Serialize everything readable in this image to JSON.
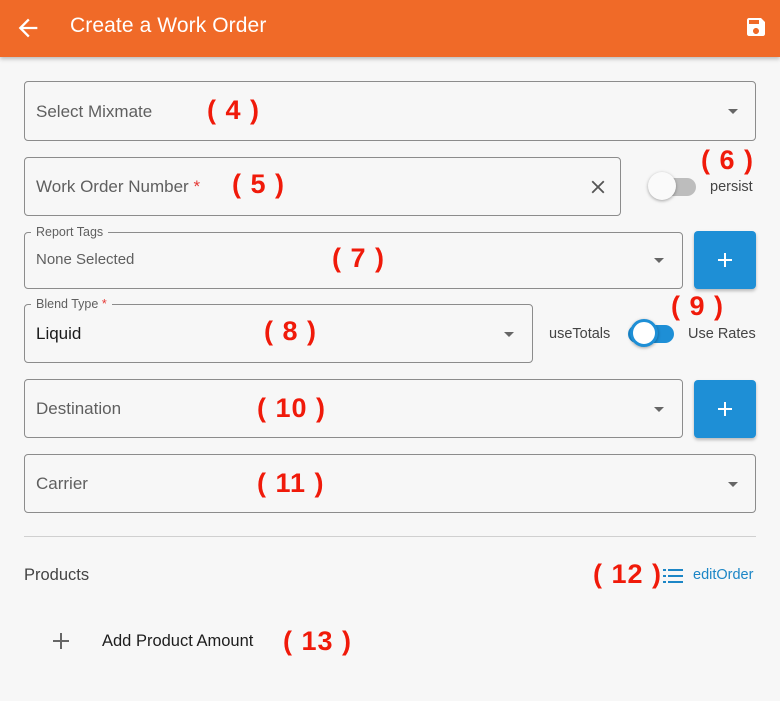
{
  "appbar": {
    "title": "Create a Work Order",
    "back_icon": "arrow-left-icon",
    "save_icon": "save-icon",
    "color": "#f06a28"
  },
  "form": {
    "mixmate": {
      "placeholder": "Select Mixmate"
    },
    "work_order": {
      "placeholder": "Work Order Number",
      "required_mark": "*",
      "clear_icon": "close-icon"
    },
    "persist": {
      "label": "persist",
      "on": false
    },
    "report_tags": {
      "legend": "Report Tags",
      "value": "None Selected"
    },
    "blend_type": {
      "legend": "Blend Type",
      "required_mark": "*",
      "value": "Liquid"
    },
    "use_totals": {
      "left_label": "useTotals",
      "right_label": "Use Rates",
      "on": true
    },
    "destination": {
      "placeholder": "Destination"
    },
    "carrier": {
      "placeholder": "Carrier"
    },
    "add_button_color": "#1e8fd6"
  },
  "products": {
    "heading": "Products",
    "edit_order_label": "editOrder",
    "add_product_label": "Add Product Amount"
  },
  "annotations": {
    "a4": "( 4 )",
    "a5": "( 5 )",
    "a6": "( 6 )",
    "a7": "( 7 )",
    "a8": "( 8 )",
    "a9": "( 9 )",
    "a10": "( 10 )",
    "a11": "( 11 )",
    "a12": "( 12 )",
    "a13": "( 13 )"
  }
}
